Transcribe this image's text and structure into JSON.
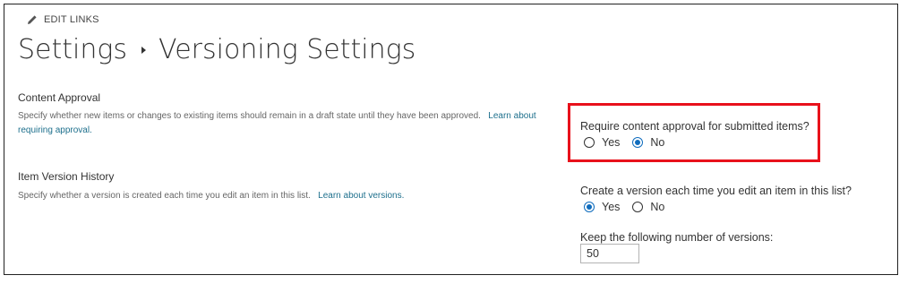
{
  "toolbar": {
    "edit_links_label": "EDIT LINKS",
    "edit_icon": "pencil-icon"
  },
  "breadcrumb": {
    "parent": "Settings",
    "current": "Versioning Settings"
  },
  "content_approval": {
    "heading": "Content Approval",
    "description": "Specify whether new items or changes to existing items should remain in a draft state until they have been approved.",
    "learn_more": "Learn about requiring approval.",
    "question": "Require content approval for submitted items?",
    "options": [
      {
        "label": "Yes",
        "selected": false
      },
      {
        "label": "No",
        "selected": true
      }
    ]
  },
  "version_history": {
    "heading": "Item Version History",
    "description": "Specify whether a version is created each time you edit an item in this list.",
    "learn_more": "Learn about versions.",
    "question": "Create a version each time you edit an item in this list?",
    "options": [
      {
        "label": "Yes",
        "selected": true
      },
      {
        "label": "No",
        "selected": false
      }
    ],
    "keep_label": "Keep the following number of versions:",
    "keep_value": "50"
  },
  "colors": {
    "highlight": "#e8111b",
    "link": "#1d6f8c",
    "radio_accent": "#0f6cbd"
  }
}
